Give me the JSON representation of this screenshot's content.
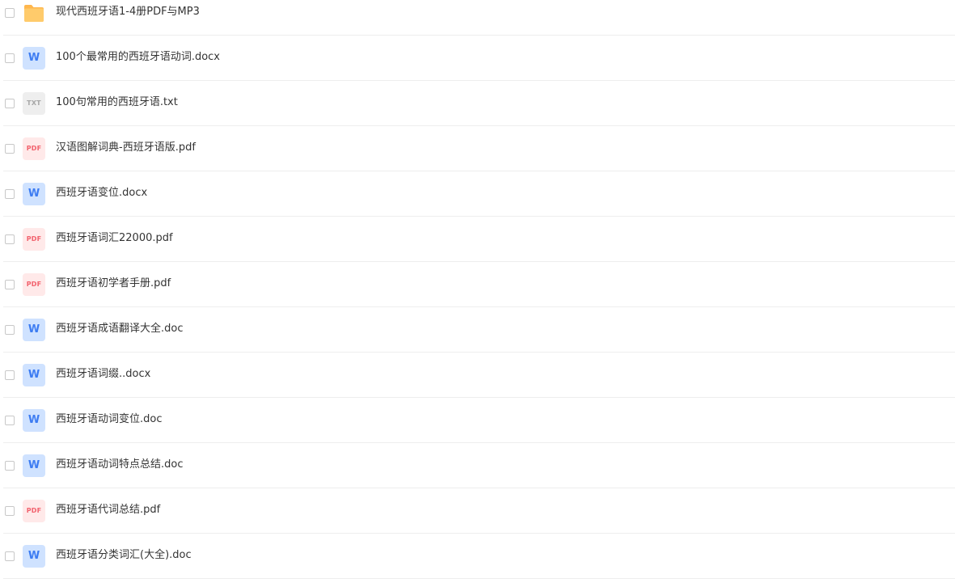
{
  "files": [
    {
      "name": "现代西班牙语1-4册PDF与MP3",
      "type": "folder",
      "icon": "folder-icon",
      "icon_label": ""
    },
    {
      "name": "100个最常用的西班牙语动词.docx",
      "type": "word",
      "icon": "word-file-icon",
      "icon_label": "W"
    },
    {
      "name": "100句常用的西班牙语.txt",
      "type": "txt",
      "icon": "txt-file-icon",
      "icon_label": "TXT"
    },
    {
      "name": "汉语图解词典-西班牙语版.pdf",
      "type": "pdf",
      "icon": "pdf-file-icon",
      "icon_label": "PDF"
    },
    {
      "name": "西班牙语变位.docx",
      "type": "word",
      "icon": "word-file-icon",
      "icon_label": "W"
    },
    {
      "name": "西班牙语词汇22000.pdf",
      "type": "pdf",
      "icon": "pdf-file-icon",
      "icon_label": "PDF"
    },
    {
      "name": "西班牙语初学者手册.pdf",
      "type": "pdf",
      "icon": "pdf-file-icon",
      "icon_label": "PDF"
    },
    {
      "name": "西班牙语成语翻译大全.doc",
      "type": "word",
      "icon": "word-file-icon",
      "icon_label": "W"
    },
    {
      "name": "西班牙语词缀..docx",
      "type": "word",
      "icon": "word-file-icon",
      "icon_label": "W"
    },
    {
      "name": "西班牙语动词变位.doc",
      "type": "word",
      "icon": "word-file-icon",
      "icon_label": "W"
    },
    {
      "name": "西班牙语动词特点总结.doc",
      "type": "word",
      "icon": "word-file-icon",
      "icon_label": "W"
    },
    {
      "name": "西班牙语代词总结.pdf",
      "type": "pdf",
      "icon": "pdf-file-icon",
      "icon_label": "PDF"
    },
    {
      "name": "西班牙语分类词汇(大全).doc",
      "type": "word",
      "icon": "word-file-icon",
      "icon_label": "W"
    }
  ],
  "colors": {
    "folder": "#ffcb6b",
    "folder_tab": "#ffb74d",
    "word": "#3d7cf2",
    "word_bg": "#cfe2ff",
    "pdf": "#f2626d",
    "pdf_bg": "#ffe9e9",
    "txt": "#a7a7a7",
    "txt_bg": "#eeeeee",
    "text": "#333333",
    "divider": "#eeeeee"
  }
}
